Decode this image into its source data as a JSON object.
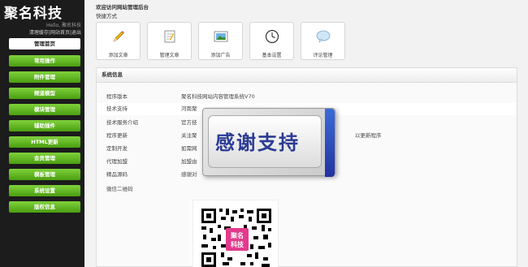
{
  "brand": {
    "logo": "聚名科技",
    "hello": "Hello, 聚名科技"
  },
  "toplinks": [
    "清理缓存",
    "网站首页",
    "退出"
  ],
  "nav": [
    {
      "label": "管理首页",
      "active": true
    },
    {
      "label": "常用操作"
    },
    {
      "label": "附件管理"
    },
    {
      "label": "频道模型"
    },
    {
      "label": "模块管理"
    },
    {
      "label": "辅助插件"
    },
    {
      "label": "HTML更新"
    },
    {
      "label": "会员管理"
    },
    {
      "label": "模板管理"
    },
    {
      "label": "系统设置"
    },
    {
      "label": "版权信息"
    }
  ],
  "header": {
    "welcome": "欢迎访问网站管理后台",
    "quick_title": "快捷方式"
  },
  "quick": [
    {
      "label": "添加文章",
      "icon": "pencil-icon"
    },
    {
      "label": "管理文章",
      "icon": "document-icon"
    },
    {
      "label": "添加广告",
      "icon": "picture-icon"
    },
    {
      "label": "基本设置",
      "icon": "clock-icon"
    },
    {
      "label": "评论管理",
      "icon": "speech-bubble-icon"
    }
  ],
  "panel": {
    "title": "系统信息",
    "rows": [
      {
        "key": "程序版本",
        "value": "聚名科技网站内容管理系统V70"
      },
      {
        "key": "技术支持",
        "value": "河南聚"
      },
      {
        "key": "技术服务介绍",
        "value": "官方技"
      },
      {
        "key": "程序更新",
        "value": "关注聚",
        "value2": "以更新程序"
      },
      {
        "key": "定制开发",
        "value": "如需网"
      },
      {
        "key": "代理加盟",
        "value": "加盟由"
      },
      {
        "key": "精品源码",
        "value": "感谢对"
      },
      {
        "key": "微信二维码",
        "value": ""
      }
    ]
  },
  "qr_badge": "聚名科技",
  "overlay": {
    "text": "感谢支持"
  }
}
